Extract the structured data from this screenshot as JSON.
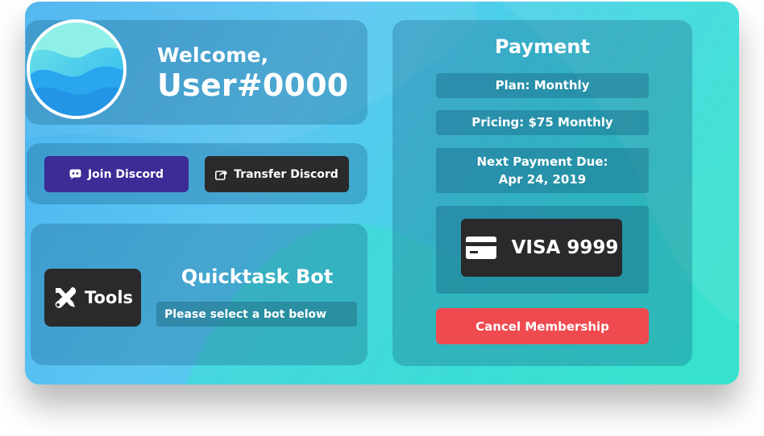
{
  "welcome": {
    "greeting": "Welcome,",
    "username": "User#0000"
  },
  "discord": {
    "join_label": "Join Discord",
    "transfer_label": "Transfer Discord"
  },
  "tools": {
    "button_label": "Tools",
    "bot_title": "Quicktask Bot",
    "bot_select_text": "Please select a bot below"
  },
  "payment": {
    "title": "Payment",
    "plan": "Plan:  Monthly",
    "pricing": "Pricing:  $75 Monthly",
    "next_due_label": "Next Payment Due:",
    "next_due_date": "Apr 24, 2019",
    "card_label": "VISA 9999",
    "cancel_label": "Cancel Membership"
  },
  "colors": {
    "join_button": "#3d2b96",
    "dark_button": "#2a2a2c",
    "cancel_button": "#ef4a4f",
    "text": "#ffffff"
  },
  "icons": {
    "join": "discord-icon",
    "transfer": "share-arrow-icon",
    "tools": "wrench-screwdriver-icon",
    "card": "credit-card-icon"
  }
}
